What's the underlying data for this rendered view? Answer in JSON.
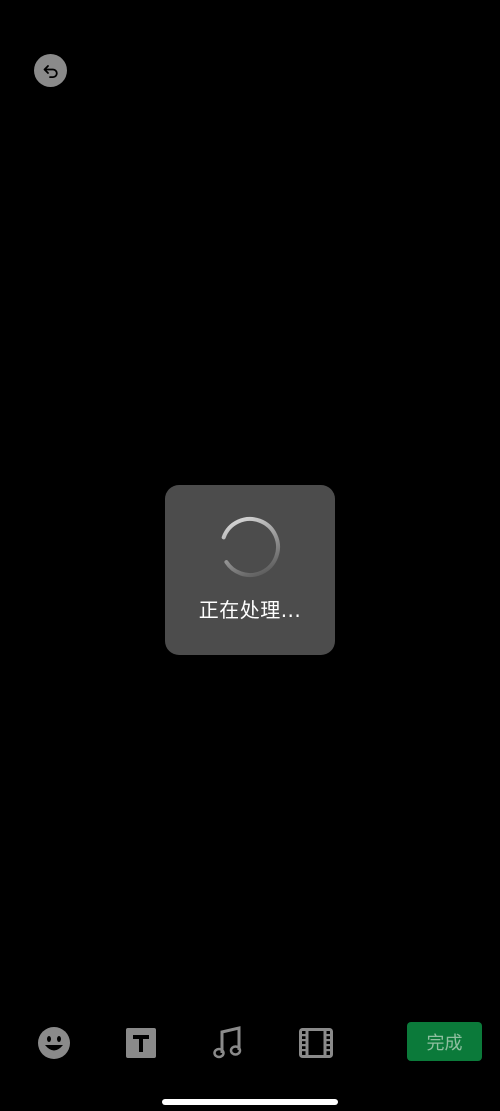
{
  "colors": {
    "background": "#000000",
    "toast_background": "#4c4c4c",
    "icon_gray": "#8a8a8a",
    "done_button_bg": "#0b7a3a",
    "done_button_text": "#8fbfa0",
    "home_indicator": "#ffffff"
  },
  "header": {
    "back_icon": "undo-arrow-icon"
  },
  "loading": {
    "spinner_icon": "spinner-icon",
    "text": "正在处理..."
  },
  "toolbar": {
    "tools": [
      {
        "icon": "emoji-icon"
      },
      {
        "icon": "text-icon"
      },
      {
        "icon": "music-icon"
      },
      {
        "icon": "film-clip-icon"
      }
    ],
    "done_label": "完成"
  }
}
